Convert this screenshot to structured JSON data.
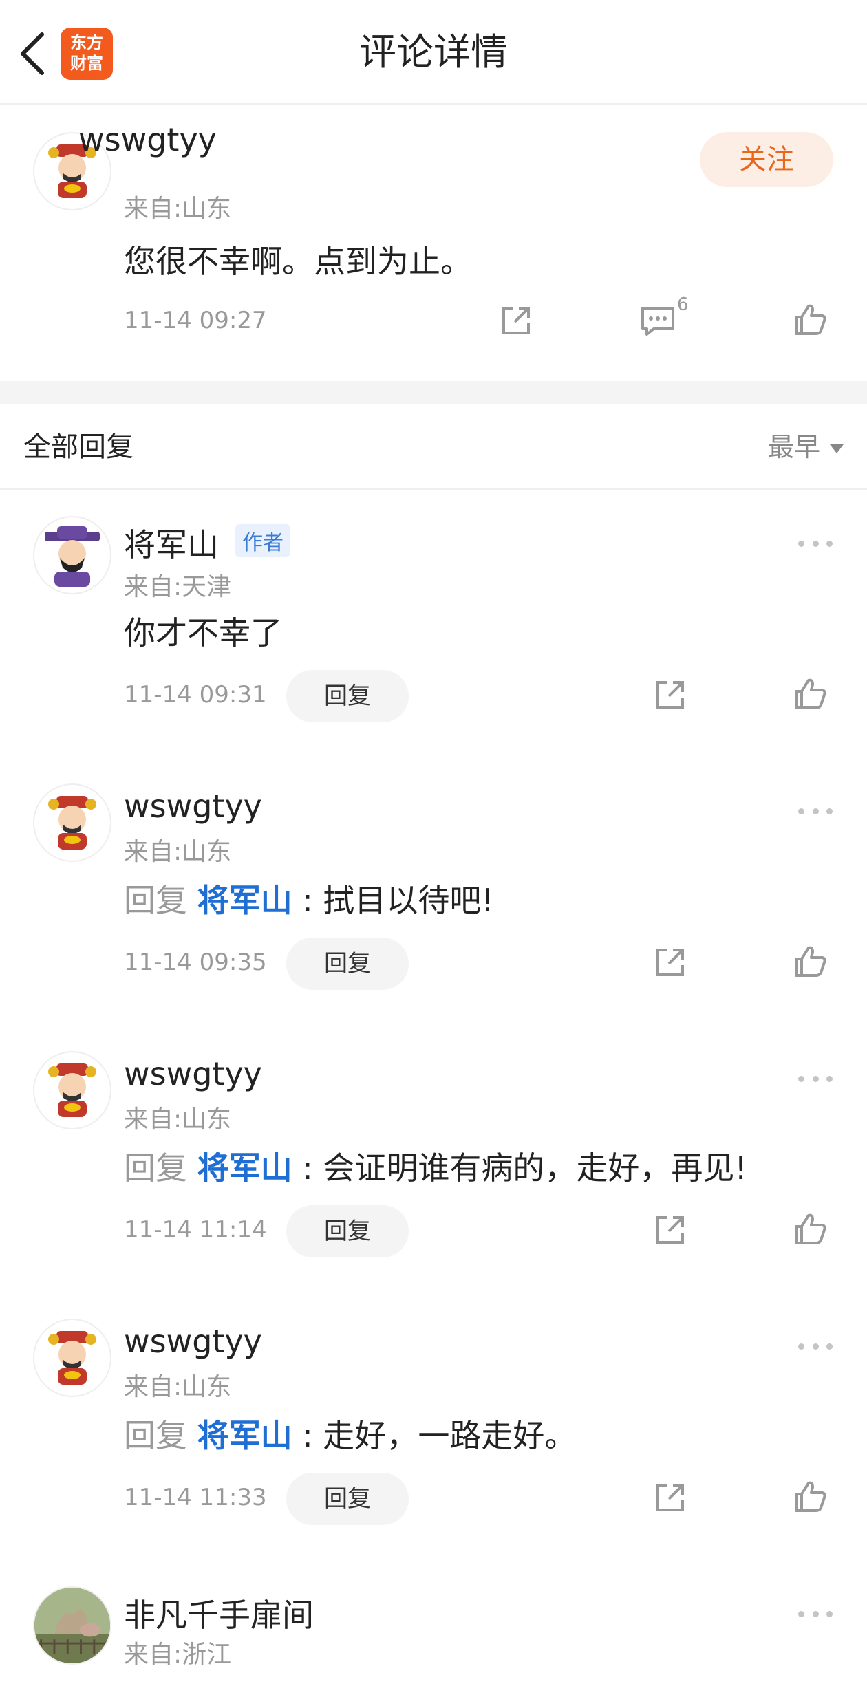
{
  "header": {
    "title": "评论详情",
    "logo_line1": "东方",
    "logo_line2": "财富"
  },
  "main_comment": {
    "username": "wswgtyy",
    "location": "来自:山东",
    "content": "您很不幸啊。点到为止。",
    "time": "11-14 09:27",
    "follow_label": "关注",
    "comment_count": "6"
  },
  "replies_section": {
    "title": "全部回复",
    "sort_label": "最早"
  },
  "replies": [
    {
      "username": "将军山",
      "author_tag": "作者",
      "location": "来自:天津",
      "content": "你才不幸了",
      "time": "11-14 09:31",
      "reply_label": "回复"
    },
    {
      "username": "wswgtyy",
      "location": "来自:山东",
      "reply_prefix": "回复",
      "reply_target": "将军山",
      "colon": ":",
      "content": "拭目以待吧!",
      "time": "11-14 09:35",
      "reply_label": "回复"
    },
    {
      "username": "wswgtyy",
      "location": "来自:山东",
      "reply_prefix": "回复",
      "reply_target": "将军山",
      "colon": ":",
      "content": "会证明谁有病的，走好，再见!",
      "time": "11-14 11:14",
      "reply_label": "回复"
    },
    {
      "username": "wswgtyy",
      "location": "来自:山东",
      "reply_prefix": "回复",
      "reply_target": "将军山",
      "colon": ":",
      "content": "走好，一路走好。",
      "time": "11-14 11:33",
      "reply_label": "回复"
    },
    {
      "username": "非凡千手扉间",
      "location": "来自:浙江"
    }
  ],
  "colors": {
    "accent_orange": "#e8671a",
    "link_blue": "#1f6ed4",
    "logo_bg": "#f25a1e"
  },
  "icons": [
    "back-arrow-icon",
    "share-icon",
    "comment-icon",
    "like-icon",
    "more-icon",
    "sort-caret-icon"
  ]
}
